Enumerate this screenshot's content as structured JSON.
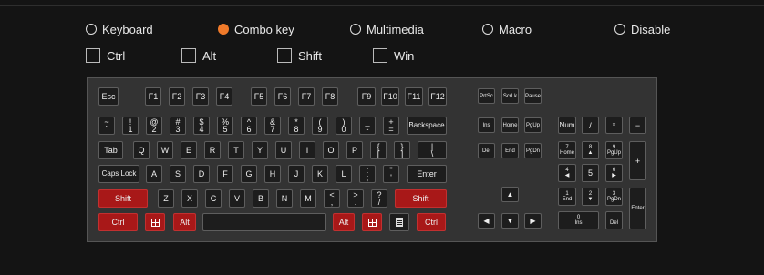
{
  "mode_options": [
    {
      "label": "Keyboard",
      "selected": false
    },
    {
      "label": "Combo key",
      "selected": true
    },
    {
      "label": "Multimedia",
      "selected": false
    },
    {
      "label": "Macro",
      "selected": false
    },
    {
      "label": "Disable",
      "selected": false
    }
  ],
  "modifiers": [
    {
      "label": "Ctrl",
      "checked": false
    },
    {
      "label": "Alt",
      "checked": false
    },
    {
      "label": "Shift",
      "checked": false
    },
    {
      "label": "Win",
      "checked": false
    }
  ],
  "colors": {
    "accent": "#f07a2a",
    "highlight_key": "#a81818",
    "keyboard_bg": "#333333",
    "key_bg": "#1d1d1d",
    "page_bg": "#141414"
  },
  "keys": [
    {
      "id": "esc",
      "label": "Esc"
    },
    {
      "id": "f1",
      "label": "F1"
    },
    {
      "id": "f2",
      "label": "F2"
    },
    {
      "id": "f3",
      "label": "F3"
    },
    {
      "id": "f4",
      "label": "F4"
    },
    {
      "id": "f5",
      "label": "F5"
    },
    {
      "id": "f6",
      "label": "F6"
    },
    {
      "id": "f7",
      "label": "F7"
    },
    {
      "id": "f8",
      "label": "F8"
    },
    {
      "id": "f9",
      "label": "F9"
    },
    {
      "id": "f10",
      "label": "F10"
    },
    {
      "id": "f11",
      "label": "F11"
    },
    {
      "id": "f12",
      "label": "F12"
    },
    {
      "id": "prtsc",
      "label": "PrtSc"
    },
    {
      "id": "scrlk",
      "label": "ScrLk"
    },
    {
      "id": "pause",
      "label": "Pause"
    },
    {
      "id": "backtick",
      "label": "~\n`"
    },
    {
      "id": "1",
      "label": "!\n1"
    },
    {
      "id": "2",
      "label": "@\n2"
    },
    {
      "id": "3",
      "label": "#\n3"
    },
    {
      "id": "4",
      "label": "$\n4"
    },
    {
      "id": "5",
      "label": "%\n5"
    },
    {
      "id": "6",
      "label": "^\n6"
    },
    {
      "id": "7",
      "label": "&\n7"
    },
    {
      "id": "8",
      "label": "*\n8"
    },
    {
      "id": "9",
      "label": "(\n9"
    },
    {
      "id": "0",
      "label": ")\n0"
    },
    {
      "id": "minus",
      "label": "_\n-"
    },
    {
      "id": "equal",
      "label": "+\n="
    },
    {
      "id": "backspace",
      "label": "Backspace"
    },
    {
      "id": "ins",
      "label": "Ins"
    },
    {
      "id": "home",
      "label": "Home"
    },
    {
      "id": "pgup",
      "label": "PgUp"
    },
    {
      "id": "numlock",
      "label": "Num"
    },
    {
      "id": "numdiv",
      "label": "/"
    },
    {
      "id": "nummul",
      "label": "*"
    },
    {
      "id": "numsub",
      "label": "−"
    },
    {
      "id": "tab",
      "label": "Tab"
    },
    {
      "id": "q",
      "label": "Q"
    },
    {
      "id": "w",
      "label": "W"
    },
    {
      "id": "e",
      "label": "E"
    },
    {
      "id": "r",
      "label": "R"
    },
    {
      "id": "t",
      "label": "T"
    },
    {
      "id": "y",
      "label": "Y"
    },
    {
      "id": "u",
      "label": "U"
    },
    {
      "id": "i",
      "label": "I"
    },
    {
      "id": "o",
      "label": "O"
    },
    {
      "id": "p",
      "label": "P"
    },
    {
      "id": "lbracket",
      "label": "{\n["
    },
    {
      "id": "rbracket",
      "label": "}\n]"
    },
    {
      "id": "backslash",
      "label": "|\n\\"
    },
    {
      "id": "del",
      "label": "Del"
    },
    {
      "id": "end",
      "label": "End"
    },
    {
      "id": "pgdn",
      "label": "PgDn"
    },
    {
      "id": "num7",
      "label": "7\nHome"
    },
    {
      "id": "num8",
      "label": "8\n▲"
    },
    {
      "id": "num9",
      "label": "9\nPgUp"
    },
    {
      "id": "numadd",
      "label": "+"
    },
    {
      "id": "capslock",
      "label": "Caps Lock"
    },
    {
      "id": "a",
      "label": "A"
    },
    {
      "id": "s",
      "label": "S"
    },
    {
      "id": "d",
      "label": "D"
    },
    {
      "id": "f",
      "label": "F"
    },
    {
      "id": "g",
      "label": "G"
    },
    {
      "id": "h",
      "label": "H"
    },
    {
      "id": "j",
      "label": "J"
    },
    {
      "id": "k",
      "label": "K"
    },
    {
      "id": "l",
      "label": "L"
    },
    {
      "id": "semicolon",
      "label": ":\n;"
    },
    {
      "id": "quote",
      "label": "\"\n'"
    },
    {
      "id": "enter",
      "label": "Enter"
    },
    {
      "id": "num4",
      "label": "4\n◀"
    },
    {
      "id": "num5",
      "label": "5"
    },
    {
      "id": "num6",
      "label": "6\n▶"
    },
    {
      "id": "lshift",
      "label": "Shift"
    },
    {
      "id": "z",
      "label": "Z"
    },
    {
      "id": "x",
      "label": "X"
    },
    {
      "id": "c",
      "label": "C"
    },
    {
      "id": "v",
      "label": "V"
    },
    {
      "id": "b",
      "label": "B"
    },
    {
      "id": "n",
      "label": "N"
    },
    {
      "id": "m",
      "label": "M"
    },
    {
      "id": "comma",
      "label": "<\n,"
    },
    {
      "id": "period",
      "label": ">\n."
    },
    {
      "id": "slash",
      "label": "?\n/"
    },
    {
      "id": "rshift",
      "label": "Shift"
    },
    {
      "id": "up",
      "label": "▲"
    },
    {
      "id": "num1",
      "label": "1\nEnd"
    },
    {
      "id": "num2",
      "label": "2\n▼"
    },
    {
      "id": "num3",
      "label": "3\nPgDn"
    },
    {
      "id": "numenter",
      "label": "Enter"
    },
    {
      "id": "lctrl",
      "label": "Ctrl"
    },
    {
      "id": "lwin",
      "label": ""
    },
    {
      "id": "lalt",
      "label": "Alt"
    },
    {
      "id": "space",
      "label": ""
    },
    {
      "id": "ralt",
      "label": "Alt"
    },
    {
      "id": "rwin",
      "label": ""
    },
    {
      "id": "menu",
      "label": ""
    },
    {
      "id": "rctrl",
      "label": "Ctrl"
    },
    {
      "id": "left",
      "label": "◀"
    },
    {
      "id": "down",
      "label": "▼"
    },
    {
      "id": "right",
      "label": "▶"
    },
    {
      "id": "num0",
      "label": "0\nIns"
    },
    {
      "id": "numdot",
      "label": ".\nDel"
    }
  ]
}
